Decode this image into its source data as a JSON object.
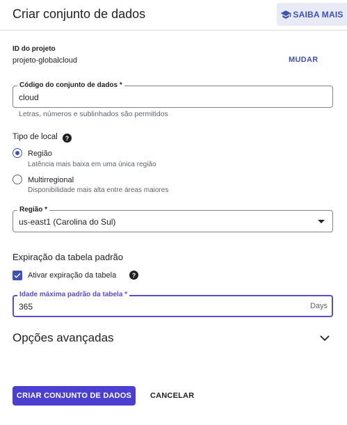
{
  "header": {
    "title": "Criar conjunto de dados",
    "learn_more": "SAIBA MAIS"
  },
  "project": {
    "label": "ID do projeto",
    "value": "projeto-globalcloud",
    "change": "MUDAR"
  },
  "dataset_code": {
    "label": "Código do conjunto de dados *",
    "value": "cloud",
    "hint": "Letras, números e sublinhados são permitidos"
  },
  "location_type": {
    "label": "Tipo de local",
    "options": [
      {
        "title": "Região",
        "subtitle": "Latência mais baixa em uma única região",
        "checked": true
      },
      {
        "title": "Multirregional",
        "subtitle": "Disponibilidade mais alta entre áreas maiores",
        "checked": false
      }
    ]
  },
  "region": {
    "label": "Região *",
    "value": "us-east1 (Carolina do Sul)"
  },
  "expiration": {
    "heading": "Expiração da tabela padrão",
    "checkbox_label": "Ativar expiração da tabela",
    "checked": true,
    "max_age_label": "Idade máxima padrão da tabela *",
    "max_age_value": "365",
    "max_age_suffix": "Days"
  },
  "advanced": {
    "label": "Opções avançadas"
  },
  "actions": {
    "create": "CRIAR CONJUNTO DE DADOS",
    "cancel": "CANCELAR"
  },
  "colors": {
    "accent": "#3f51b5",
    "primary_button": "#4b3fd1",
    "focus": "#5c4bd9"
  }
}
